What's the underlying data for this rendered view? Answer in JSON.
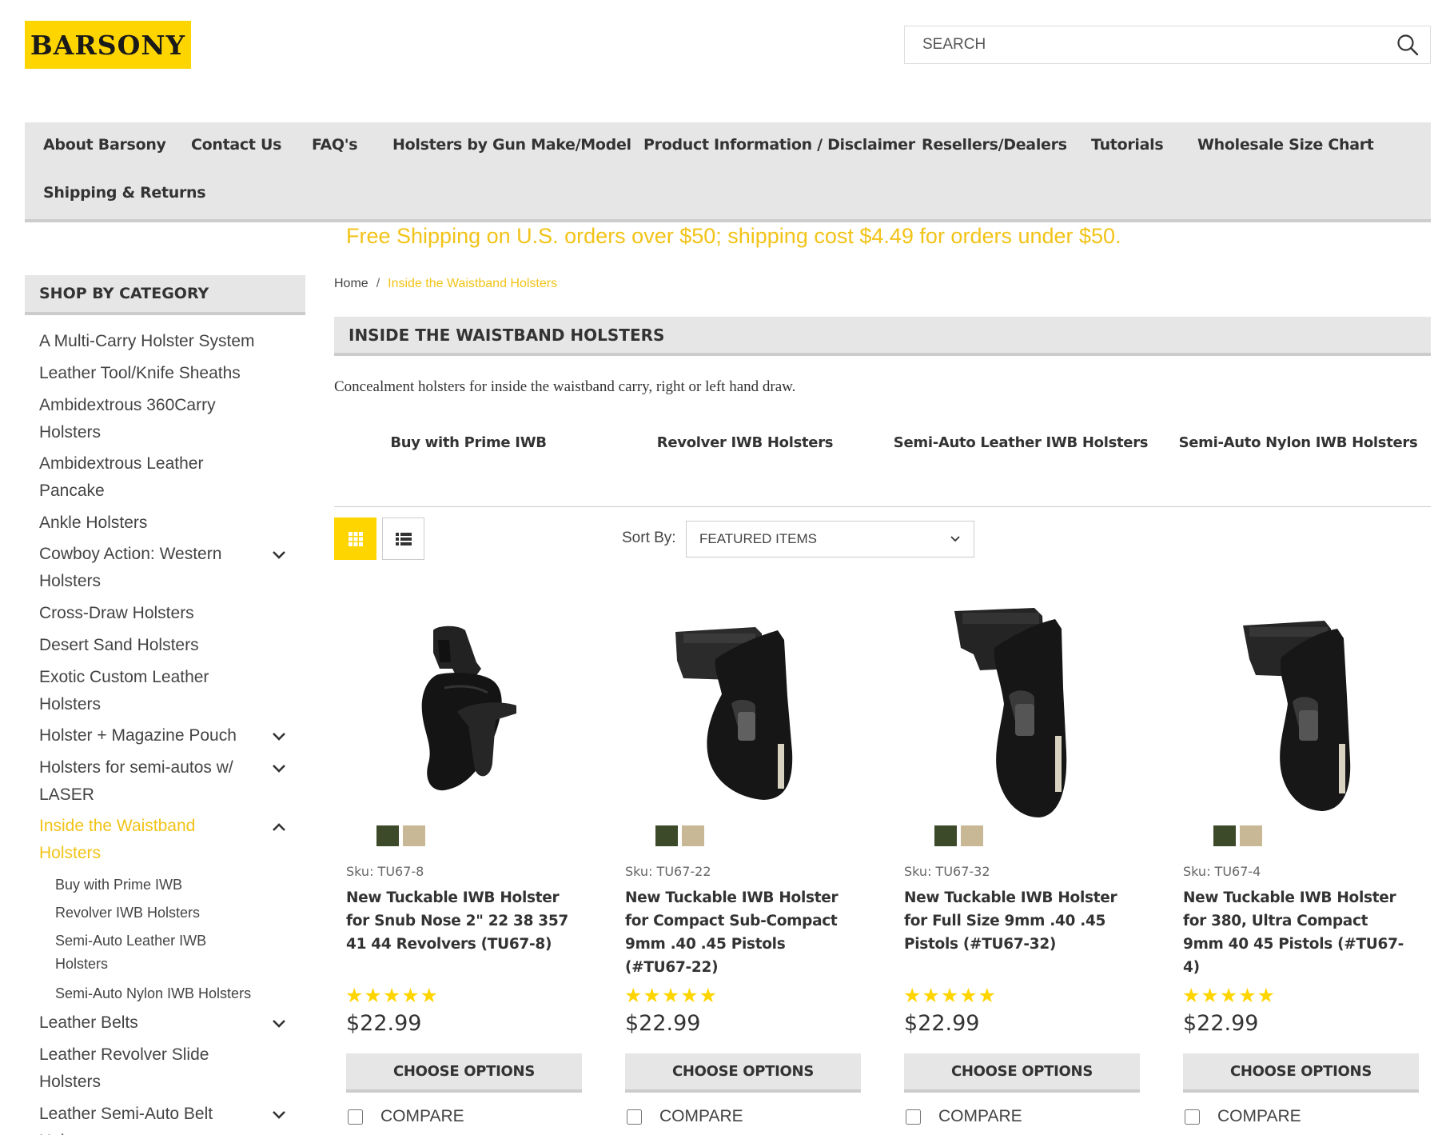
{
  "header": {
    "logo_text": "BARSONY",
    "search_placeholder": "SEARCH",
    "brand_yellow": "#ffd500",
    "accent_yellow": "#f2c318"
  },
  "nav": {
    "items": [
      "About Barsony",
      "Contact Us",
      "FAQ's",
      "Holsters by Gun Make/Model",
      "Product Information / Disclaimer",
      "Resellers/Dealers",
      "Tutorials",
      "Wholesale Size Chart",
      "Shipping & Returns"
    ]
  },
  "promo": "Free Shipping on U.S. orders over $50; shipping cost $4.49 for orders under $50.",
  "sidebar": {
    "heading": "SHOP BY CATEGORY",
    "categories": [
      {
        "label": "A Multi-Carry Holster System",
        "has_children": false
      },
      {
        "label": "Leather Tool/Knife Sheaths",
        "has_children": false
      },
      {
        "label": "Ambidextrous 360Carry Holsters",
        "has_children": false
      },
      {
        "label": "Ambidextrous Leather Pancake",
        "has_children": false
      },
      {
        "label": "Ankle Holsters",
        "has_children": false
      },
      {
        "label": "Cowboy Action: Western Holsters",
        "has_children": true
      },
      {
        "label": "Cross-Draw Holsters",
        "has_children": false
      },
      {
        "label": "Desert Sand Holsters",
        "has_children": false
      },
      {
        "label": "Exotic Custom Leather Holsters",
        "has_children": false
      },
      {
        "label": "Holster + Magazine Pouch",
        "has_children": true
      },
      {
        "label": "Holsters for semi-autos w/ LASER",
        "has_children": true
      },
      {
        "label": "Inside the Waistband Holsters",
        "has_children": true,
        "active": true
      },
      {
        "label": "Leather Belts",
        "has_children": true
      },
      {
        "label": "Leather Revolver Slide Holsters",
        "has_children": false
      },
      {
        "label": "Leather Semi-Auto Belt Holsters",
        "has_children": true
      }
    ],
    "subcategories": [
      "Buy with Prime IWB",
      "Revolver IWB Holsters",
      "Semi-Auto Leather IWB Holsters",
      "Semi-Auto Nylon IWB Holsters"
    ]
  },
  "breadcrumb": {
    "home": "Home",
    "separator": "/",
    "current": "Inside the Waistband Holsters"
  },
  "page": {
    "title": "INSIDE THE WAISTBAND HOLSTERS",
    "description": "Concealment holsters for inside the waistband carry, right or left hand draw.",
    "subcategory_links": [
      "Buy with Prime IWB",
      "Revolver IWB Holsters",
      "Semi-Auto Leather IWB Holsters",
      "Semi-Auto Nylon IWB Holsters"
    ]
  },
  "toolbar": {
    "sort_label": "Sort By:",
    "sort_value": "FEATURED ITEMS",
    "grid_icon": "grid-view-icon",
    "list_icon": "list-view-icon"
  },
  "products": [
    {
      "sku": "Sku: TU67-8",
      "name": "New Tuckable IWB Holster for Snub Nose 2\" 22 38 357 41 44 Revolvers (TU67-8)",
      "rating": 5,
      "stars": "★★★★★",
      "price": "$22.99",
      "cta": "CHOOSE OPTIONS",
      "compare": "COMPARE",
      "swatches": [
        "#3d4a2a",
        "#c8b896"
      ]
    },
    {
      "sku": "Sku: TU67-22",
      "name": "New Tuckable IWB Holster for Compact Sub-Compact 9mm .40 .45 Pistols (#TU67-22)",
      "rating": 5,
      "stars": "★★★★★",
      "price": "$22.99",
      "cta": "CHOOSE OPTIONS",
      "compare": "COMPARE",
      "swatches": [
        "#3d4a2a",
        "#c8b896"
      ]
    },
    {
      "sku": "Sku: TU67-32",
      "name": "New Tuckable IWB Holster for Full Size 9mm .40 .45 Pistols (#TU67-32)",
      "rating": 5,
      "stars": "★★★★★",
      "price": "$22.99",
      "cta": "CHOOSE OPTIONS",
      "compare": "COMPARE",
      "swatches": [
        "#3d4a2a",
        "#c8b896"
      ]
    },
    {
      "sku": "Sku: TU67-4",
      "name": "New Tuckable IWB Holster for 380, Ultra Compact 9mm 40 45 Pistols (#TU67-4)",
      "rating": 5,
      "stars": "★★★★★",
      "price": "$22.99",
      "cta": "CHOOSE OPTIONS",
      "compare": "COMPARE",
      "swatches": [
        "#3d4a2a",
        "#c8b896"
      ]
    }
  ]
}
